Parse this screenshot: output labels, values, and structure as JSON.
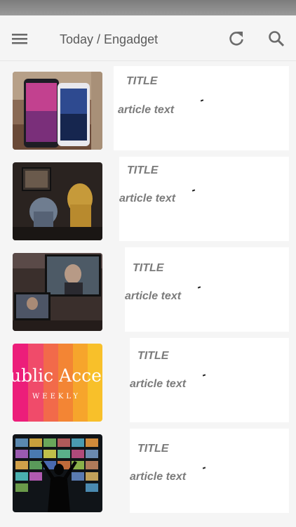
{
  "toolbar": {
    "title": "Today / Engadget",
    "icons": [
      "menu-icon",
      "refresh-icon",
      "search-icon"
    ]
  },
  "articles": [
    {
      "title": "TITLE",
      "text": "article text",
      "thumb": "phones"
    },
    {
      "title": "TITLE",
      "text": "article text",
      "thumb": "robots"
    },
    {
      "title": "TITLE",
      "text": "article text",
      "thumb": "video-call"
    },
    {
      "title": "TITLE",
      "text": "article text",
      "thumb": "public-access",
      "thumb_caption_main": "ublic Acces",
      "thumb_caption_sub": "WEEKLY"
    },
    {
      "title": "TITLE",
      "text": "article text",
      "thumb": "tv-wall"
    }
  ],
  "colors": {
    "status_bar": "#8a8a8a",
    "toolbar_bg": "#f5f5f5",
    "icon": "#6b6b6b",
    "text": "#7b7b7b"
  }
}
